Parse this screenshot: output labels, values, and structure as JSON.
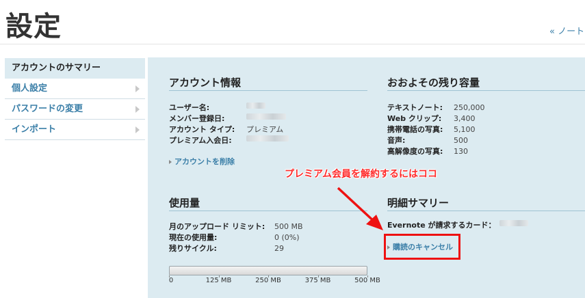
{
  "header": {
    "title": "設定",
    "back_link": "« ノートに戻る"
  },
  "sidebar": {
    "items": [
      {
        "label": "アカウントのサマリー",
        "active": true
      },
      {
        "label": "個人設定"
      },
      {
        "label": "パスワードの変更"
      },
      {
        "label": "インポート"
      }
    ]
  },
  "account_info": {
    "heading": "アカウント情報",
    "rows": [
      {
        "key": "ユーザー名:",
        "value": ""
      },
      {
        "key": "メンバー登録日:",
        "value": ""
      },
      {
        "key": "アカウント タイプ:",
        "value": "プレミアム"
      },
      {
        "key": "プレミアム入会日:",
        "value": ""
      }
    ],
    "delete_link": "アカウントを削除"
  },
  "remaining": {
    "heading": "おおよその残り容量",
    "rows": [
      {
        "key": "テキストノート:",
        "value": "250,000"
      },
      {
        "key": "Web クリップ:",
        "value": "3,400"
      },
      {
        "key": "携帯電話の写真:",
        "value": "5,100"
      },
      {
        "key": "音声:",
        "value": "500"
      },
      {
        "key": "高解像度の写真:",
        "value": "130"
      }
    ]
  },
  "usage": {
    "heading": "使用量",
    "rows": [
      {
        "key": "月のアップロード リミット:",
        "value": "500 MB"
      },
      {
        "key": "現在の使用量:",
        "value": "0 (0%)"
      },
      {
        "key": "残りサイクル:",
        "value": "29"
      }
    ],
    "fill_fraction": 0,
    "ticks": [
      "0",
      "125 MB",
      "250 MB",
      "375 MB",
      "500 MB"
    ]
  },
  "billing": {
    "heading": "明細サマリー",
    "card_label": "Evernote が請求するカード：",
    "card_value": "",
    "cancel_link": "購読のキャンセル"
  },
  "annotation": {
    "text": "プレミアム会員を解約するにはココ",
    "color": "#ff2a2a"
  }
}
